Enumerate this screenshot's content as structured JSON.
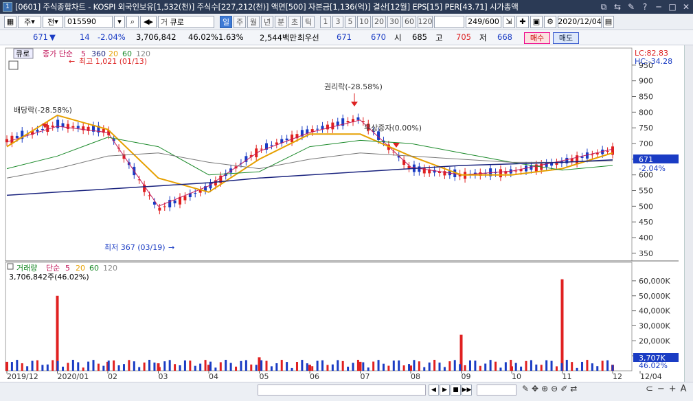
{
  "window": {
    "app_badge": "1",
    "title": "[0601] 주식종합차트 - KOSPI 외국인보유[1,532(천)] 주식수[227,212(천)] 액면[500] 자본금[1,136(억)] 결산[12월] EPS[15] PER[43.71] 시가총액",
    "controls": [
      "⧉",
      "⇆",
      "✎",
      "?",
      "─",
      "□",
      "✕"
    ]
  },
  "toolbar": {
    "market": "주",
    "prev_label": "전",
    "code": "015590",
    "stock_name": "큐로",
    "periods": [
      "일",
      "주",
      "월",
      "년",
      "분",
      "초",
      "틱"
    ],
    "active_period": "일",
    "intervals": [
      "1",
      "3",
      "5",
      "10",
      "20",
      "30",
      "60",
      "120"
    ],
    "count": "249/600",
    "date": "2020/12/04"
  },
  "quote": {
    "price": "671",
    "arrow": "▼",
    "change": "14",
    "change_pct": "-2.04%",
    "volume": "3,706,842",
    "vol_ratio": "46.02%",
    "turnover": "1.63%",
    "amount": "2,544백만",
    "best_bid_label": "최우선",
    "ask": "671",
    "bid": "670",
    "open_label": "시",
    "open": "685",
    "high_label": "고",
    "high": "705",
    "low_label": "저",
    "low": "668",
    "buy": "매수",
    "sell": "매도"
  },
  "price_panel": {
    "stock_name": "큐로",
    "legend_title": "종가 단순",
    "ma": [
      "5",
      "360",
      "20",
      "60",
      "120"
    ],
    "lc": "LC:82.83",
    "hc": "HC:-34.28",
    "current_label": "671",
    "current_pct": "-2.04%",
    "annotations": {
      "high": "최고 1,021 (01/13)",
      "low": "최저 367 (03/19)",
      "dividend": "배당락(-28.58%)",
      "rights": "권리락(-28.58%)",
      "bonus": "무상증자(0.00%)"
    }
  },
  "volume_panel": {
    "title": "거래량",
    "legend_title": "단순",
    "ma": [
      "5",
      "20",
      "60",
      "120"
    ],
    "summary": "3,706,842주(46.02%)",
    "current_label": "3,707K",
    "current_pct": "46.02%"
  },
  "x_axis": [
    "2019/12",
    "2020/01",
    "02",
    "03",
    "04",
    "05",
    "06",
    "07",
    "08",
    "09",
    "10",
    "11",
    "12",
    "12/04"
  ],
  "chart_data": [
    {
      "type": "line",
      "title": "",
      "ylabel": "",
      "ylim": [
        330,
        1000
      ],
      "y_ticks": [
        350,
        400,
        450,
        500,
        550,
        600,
        650,
        700,
        750,
        800,
        850,
        900,
        950
      ],
      "x": [
        "2019/12",
        "2020/01",
        "02",
        "03",
        "04",
        "05",
        "06",
        "07",
        "08",
        "09",
        "10",
        "11",
        "12"
      ],
      "series": [
        {
          "name": "종가",
          "values": [
            710,
            760,
            740,
            490,
            560,
            680,
            740,
            780,
            620,
            600,
            610,
            640,
            680
          ]
        },
        {
          "name": "5",
          "values": [
            705,
            755,
            735,
            500,
            565,
            675,
            735,
            775,
            625,
            600,
            612,
            645,
            682
          ]
        },
        {
          "name": "20",
          "values": [
            690,
            790,
            745,
            590,
            545,
            650,
            730,
            730,
            660,
            600,
            600,
            620,
            670
          ]
        },
        {
          "name": "60",
          "values": [
            620,
            660,
            720,
            690,
            600,
            610,
            690,
            710,
            700,
            670,
            640,
            615,
            630
          ]
        },
        {
          "name": "120",
          "values": [
            590,
            620,
            660,
            670,
            640,
            620,
            650,
            670,
            660,
            650,
            640,
            640,
            645
          ]
        },
        {
          "name": "360",
          "values": [
            535,
            545,
            555,
            565,
            575,
            590,
            600,
            610,
            620,
            630,
            635,
            640,
            648
          ]
        }
      ]
    },
    {
      "type": "bar",
      "title": "",
      "ylabel": "",
      "ylim": [
        0,
        65000
      ],
      "y_ticks_labels": [
        "10,000K",
        "20,000K",
        "30,000K",
        "40,000K",
        "50,000K",
        "60,000K"
      ],
      "categories": [
        "2019/12",
        "2020/01",
        "02",
        "03",
        "04",
        "05",
        "06",
        "07",
        "08",
        "09",
        "10",
        "11",
        "12"
      ],
      "values": [
        6000,
        50000,
        6000,
        5000,
        4000,
        9000,
        4000,
        6000,
        3500,
        24000,
        3000,
        61000,
        4000
      ]
    }
  ]
}
